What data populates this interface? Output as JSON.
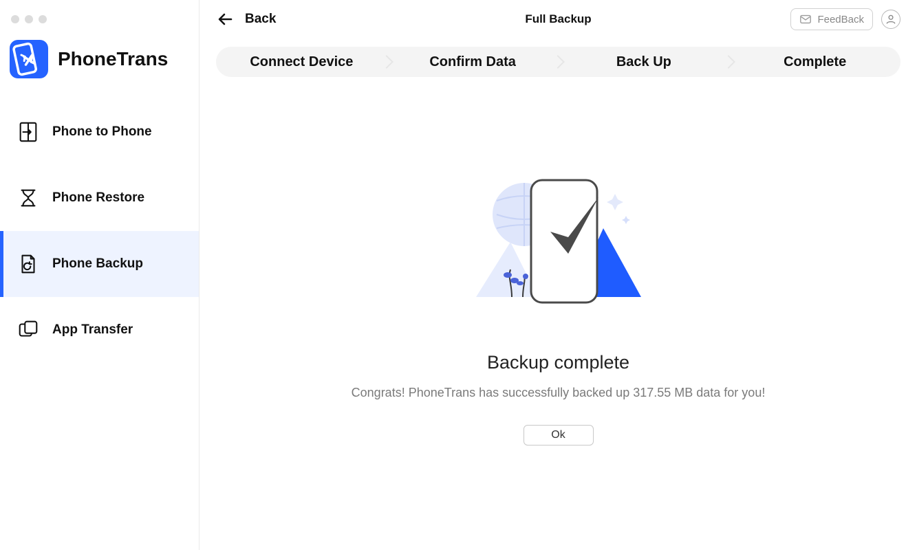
{
  "app": {
    "name": "PhoneTrans"
  },
  "sidebar": {
    "items": [
      {
        "label": "Phone to Phone"
      },
      {
        "label": "Phone Restore"
      },
      {
        "label": "Phone Backup"
      },
      {
        "label": "App Transfer"
      }
    ],
    "active_index": 2
  },
  "topbar": {
    "back_label": "Back",
    "title": "Full Backup",
    "feedback_label": "FeedBack"
  },
  "steps": [
    "Connect Device",
    "Confirm Data",
    "Back Up",
    "Complete"
  ],
  "result": {
    "title": "Backup complete",
    "message": "Congrats! PhoneTrans has successfully backed up 317.55 MB data for you!",
    "ok_label": "Ok"
  }
}
